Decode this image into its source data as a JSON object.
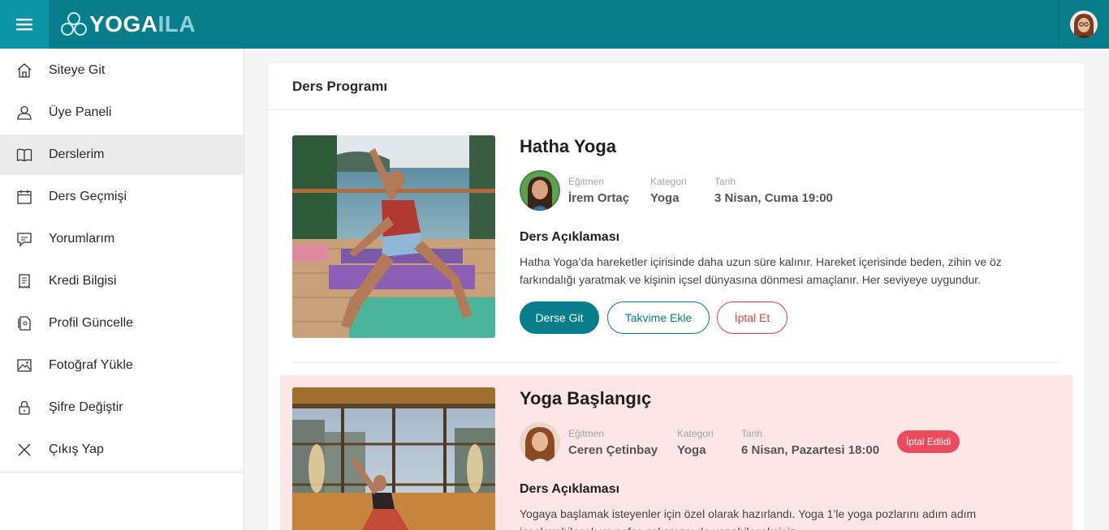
{
  "app": {
    "logo_main": "YOGA",
    "logo_accent": "ILA"
  },
  "sidebar": {
    "items": [
      {
        "label": "Siteye Git",
        "icon": "home-icon"
      },
      {
        "label": "Üye Paneli",
        "icon": "user-icon"
      },
      {
        "label": "Derslerim",
        "icon": "book-icon"
      },
      {
        "label": "Ders Geçmişi",
        "icon": "calendar-icon"
      },
      {
        "label": "Yorumlarım",
        "icon": "comment-icon"
      },
      {
        "label": "Kredi Bilgisi",
        "icon": "receipt-icon"
      },
      {
        "label": "Profil Güncelle",
        "icon": "profile-edit-icon"
      },
      {
        "label": "Fotoğraf Yükle",
        "icon": "image-icon"
      },
      {
        "label": "Şifre Değiştir",
        "icon": "lock-icon"
      },
      {
        "label": "Çıkış Yap",
        "icon": "close-icon"
      }
    ],
    "active_index": 2
  },
  "main": {
    "title": "Ders Programı",
    "lessons": [
      {
        "title": "Hatha Yoga",
        "instructor_label": "Eğitmen",
        "instructor": "İrem Ortaç",
        "category_label": "Kategori",
        "category": "Yoga",
        "date_label": "Tarih",
        "date": "3 Nisan, Cuma 19:00",
        "desc_title": "Ders Açıklaması",
        "desc": "Hatha Yoga’da hareketler içirisinde daha uzun süre kalınır. Hareket içerisinde beden, zihin ve öz farkındalığı yaratmak ve kişinin içsel dünyasına dönmesi amaçlanır. Her seviyeye uygundur.",
        "btn_go": "Derse Git",
        "btn_calendar": "Takvime Ekle",
        "btn_cancel": "İptal Et"
      },
      {
        "title": "Yoga Başlangıç",
        "instructor_label": "Eğitmen",
        "instructor": "Ceren Çetinbay",
        "category_label": "Kategori",
        "category": "Yoga",
        "date_label": "Tarih",
        "date": "6 Nisan, Pazartesi 18:00",
        "status": "İptal Edildi",
        "desc_title": "Ders Açıklaması",
        "desc": "Yogaya başlamak isteyenler için özel olarak hazırlandı. Yoga 1’le yoga pozlarını adım adım inceleyebilecek ve nefes çalışması da yapabileceksiniz."
      }
    ]
  },
  "colors": {
    "brand": "#087d8c",
    "brand_light": "#0b95a5",
    "cancel": "#d9463f",
    "cancelled_bg": "#fde6e5",
    "badge": "#ea4c5d"
  }
}
